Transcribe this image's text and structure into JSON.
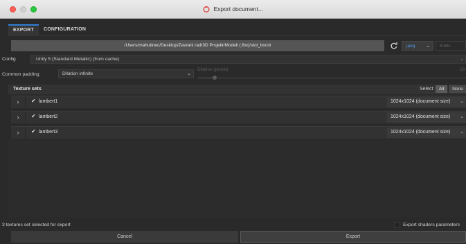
{
  "window": {
    "title": "Export document...",
    "icon": "painter-logo-icon"
  },
  "tabs": [
    {
      "label": "EXPORT",
      "active": true
    },
    {
      "label": "CONFIGURATION",
      "active": false
    }
  ],
  "output": {
    "path": "/Users/mahutinec/Desktop/Zavrani rad/3D Projekt/Modeli (.fbx)/stol_bocni",
    "format": "jpeg",
    "bits_placeholder": "8 bits"
  },
  "config": {
    "label": "Config",
    "value": "Unity 5 (Standard Metallic) (from cache)"
  },
  "padding": {
    "label": "Common padding",
    "value": "Dilation infinite",
    "dilation_label": "Dilation (pixels)",
    "dilation_value": "16"
  },
  "texture_sets": {
    "title": "Texture sets",
    "select_label": "Select",
    "all_label": "All",
    "none_label": "None",
    "items": [
      {
        "name": "lambert1",
        "checked": true,
        "size": "1024x1024 (document size)"
      },
      {
        "name": "lambert2",
        "checked": true,
        "size": "1024x1024 (document size)"
      },
      {
        "name": "lambert3",
        "checked": true,
        "size": "1024x1024 (document size)"
      }
    ]
  },
  "footer": {
    "status": "3 textures set selected for export",
    "export_shaders_label": "Export shaders parameters",
    "export_shaders_checked": false,
    "cancel_label": "Cancel",
    "export_label": "Export"
  },
  "colors": {
    "accent": "#2f7fd6",
    "format_text": "#4f9ae6",
    "close": "#fe5f57",
    "maximize": "#28c840",
    "background": "#2a2a2a"
  }
}
